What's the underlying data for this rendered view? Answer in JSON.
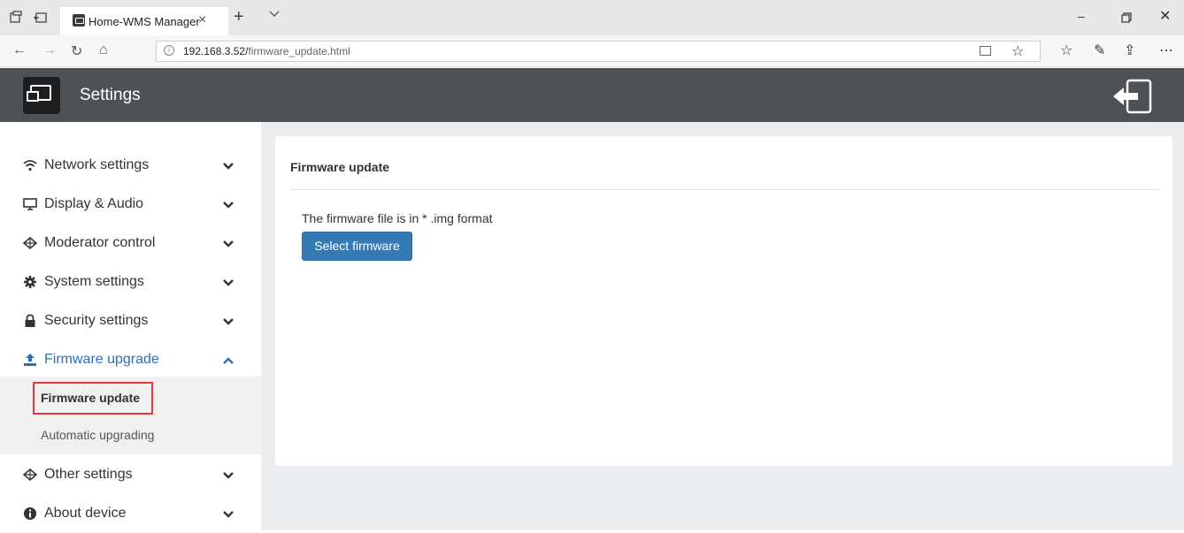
{
  "browser": {
    "tab_title": "Home-WMS Manager",
    "url_host": "192.168.3.52/",
    "url_path": "firmware_update.html"
  },
  "header": {
    "title": "Settings"
  },
  "sidebar": {
    "items": [
      {
        "label": "Network settings",
        "icon": "wifi-icon"
      },
      {
        "label": "Display & Audio",
        "icon": "monitor-icon"
      },
      {
        "label": "Moderator control",
        "icon": "moderator-icon"
      },
      {
        "label": "System settings",
        "icon": "gear-icon"
      },
      {
        "label": "Security settings",
        "icon": "lock-icon"
      },
      {
        "label": "Firmware upgrade",
        "icon": "upload-icon"
      },
      {
        "label": "Other settings",
        "icon": "moderator-icon"
      },
      {
        "label": "About device",
        "icon": "info-icon"
      }
    ],
    "submenu": [
      {
        "label": "Firmware update"
      },
      {
        "label": "Automatic upgrading"
      }
    ]
  },
  "main": {
    "title": "Firmware update",
    "note": "The firmware file is in * .img format",
    "select_button": "Select firmware"
  },
  "colors": {
    "header_bg": "#4f5254",
    "accent": "#2c6fb7",
    "button": "#337ab7",
    "highlight": "#e0393e"
  }
}
